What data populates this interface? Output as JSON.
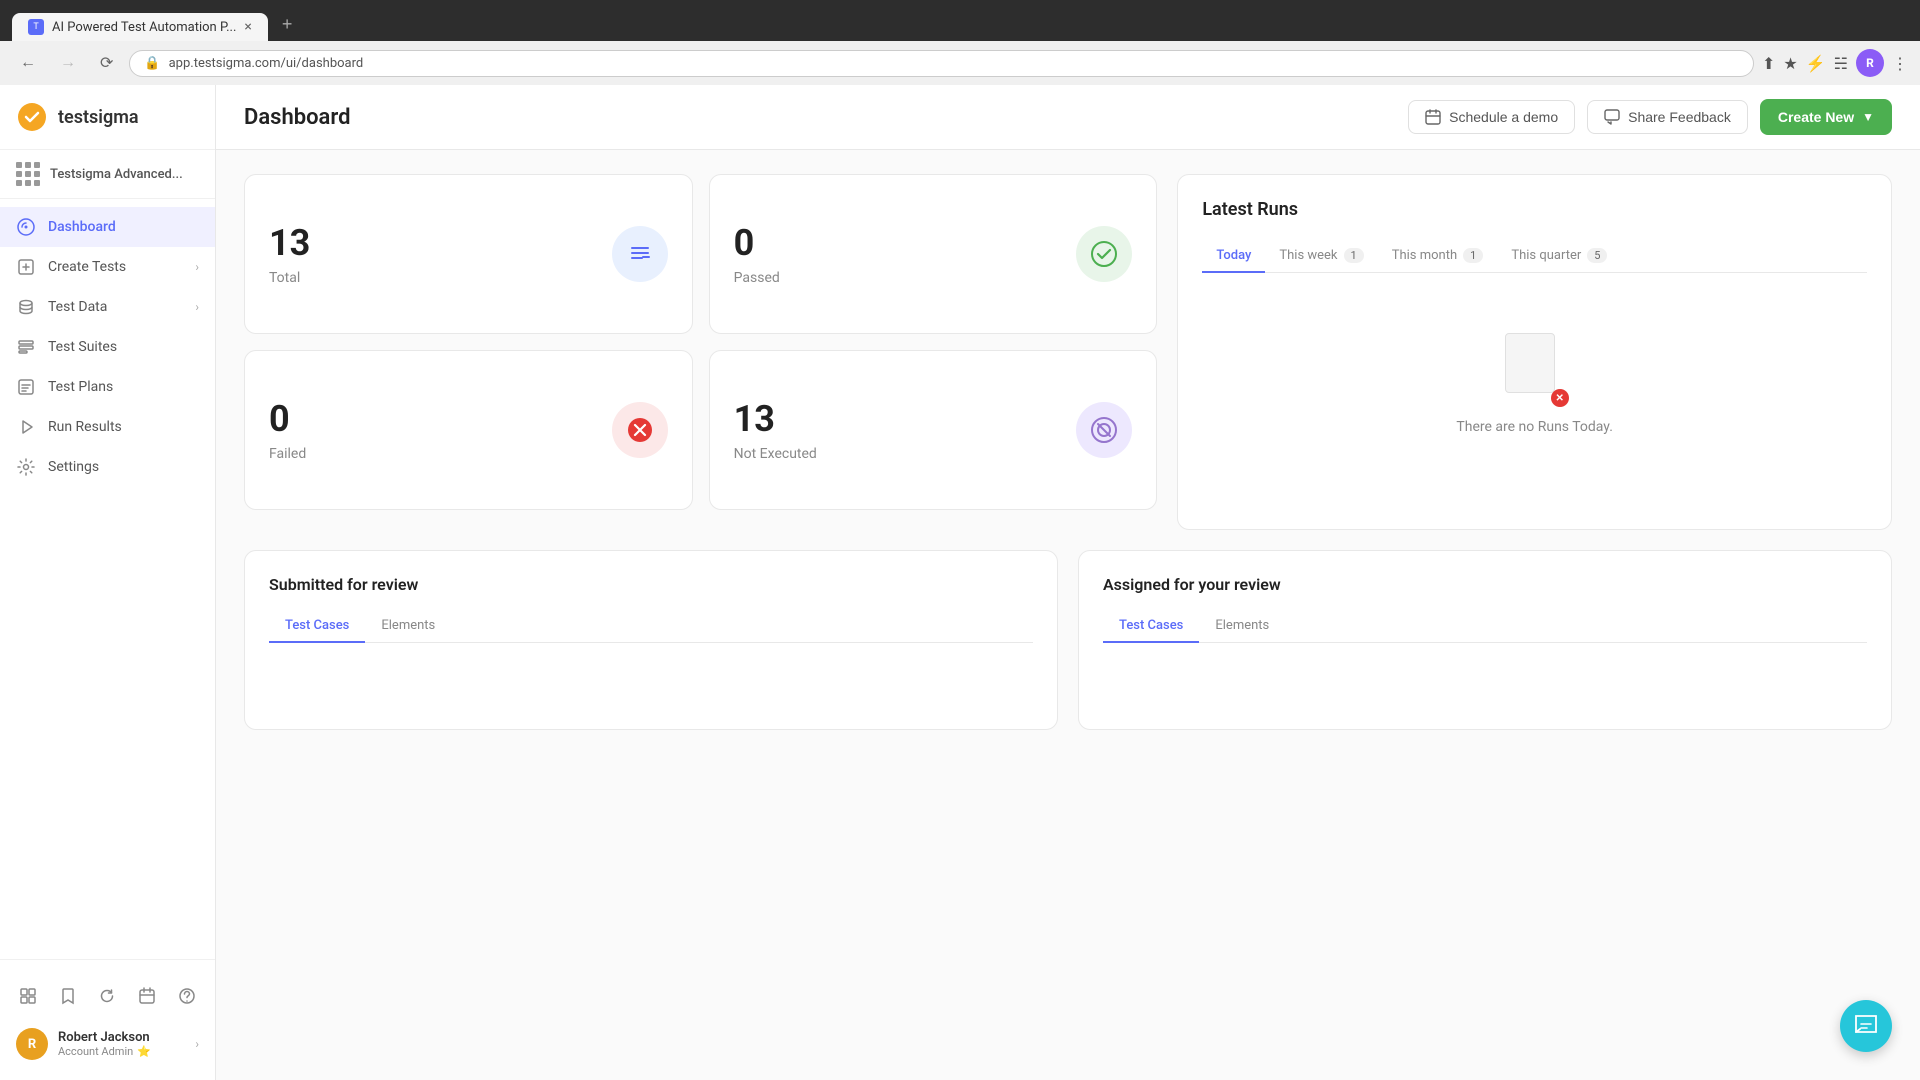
{
  "browser": {
    "tab_title": "AI Powered Test Automation P...",
    "tab_favicon": "T",
    "url": "app.testsigma.com/ui/dashboard"
  },
  "sidebar": {
    "logo_text": "testsigma",
    "workspace_name": "Testsigma Advanced...",
    "nav_items": [
      {
        "id": "dashboard",
        "label": "Dashboard",
        "active": true,
        "has_chevron": false
      },
      {
        "id": "create-tests",
        "label": "Create Tests",
        "active": false,
        "has_chevron": true
      },
      {
        "id": "test-data",
        "label": "Test Data",
        "active": false,
        "has_chevron": true
      },
      {
        "id": "test-suites",
        "label": "Test Suites",
        "active": false,
        "has_chevron": false
      },
      {
        "id": "test-plans",
        "label": "Test Plans",
        "active": false,
        "has_chevron": false
      },
      {
        "id": "run-results",
        "label": "Run Results",
        "active": false,
        "has_chevron": false
      },
      {
        "id": "settings",
        "label": "Settings",
        "active": false,
        "has_chevron": false
      }
    ],
    "user": {
      "name": "Robert Jackson",
      "role": "Account Admin",
      "initials": "R"
    }
  },
  "header": {
    "title": "Dashboard",
    "btn_schedule": "Schedule a demo",
    "btn_feedback": "Share Feedback",
    "btn_create": "Create New"
  },
  "stats": {
    "total": {
      "value": "13",
      "label": "Total"
    },
    "passed": {
      "value": "0",
      "label": "Passed"
    },
    "failed": {
      "value": "0",
      "label": "Failed"
    },
    "not_executed": {
      "value": "13",
      "label": "Not Executed"
    }
  },
  "latest_runs": {
    "title": "Latest Runs",
    "tabs": [
      {
        "id": "today",
        "label": "Today",
        "active": true,
        "badge": null
      },
      {
        "id": "this-week",
        "label": "This week",
        "active": false,
        "badge": "1"
      },
      {
        "id": "this-month",
        "label": "This month",
        "active": false,
        "badge": "1"
      },
      {
        "id": "this-quarter",
        "label": "This quarter",
        "active": false,
        "badge": "5"
      }
    ],
    "empty_message": "There are no Runs Today."
  },
  "submitted_review": {
    "title": "Submitted for review",
    "tabs": [
      {
        "label": "Test Cases",
        "active": true
      },
      {
        "label": "Elements",
        "active": false
      }
    ]
  },
  "assigned_review": {
    "title": "Assigned for your review",
    "tabs": [
      {
        "label": "Test Cases",
        "active": true
      },
      {
        "label": "Elements",
        "active": false
      }
    ]
  }
}
